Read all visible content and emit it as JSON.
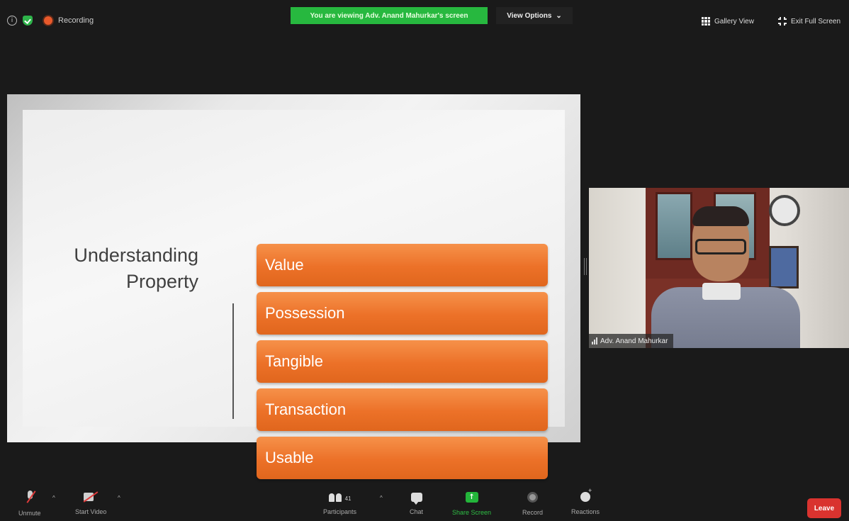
{
  "top_bar": {
    "recording_label": "Recording",
    "viewing_banner": "You are viewing Adv. Anand Mahurkar's screen",
    "view_options_label": "View Options",
    "gallery_view_label": "Gallery View",
    "exit_full_screen_label": "Exit Full Screen"
  },
  "slide": {
    "title_line1": "Understanding",
    "title_line2": "Property",
    "items": [
      "Value",
      "Possession",
      "Tangible",
      "Transaction",
      "Usable"
    ],
    "accent_color": "#ED7D31"
  },
  "video": {
    "participant_name": "Adv. Anand Mahurkar"
  },
  "toolbar": {
    "unmute_label": "Unmute",
    "start_video_label": "Start Video",
    "participants_label": "Participants",
    "participants_count": "41",
    "chat_label": "Chat",
    "share_screen_label": "Share Screen",
    "record_label": "Record",
    "reactions_label": "Reactions",
    "leave_label": "Leave"
  },
  "colors": {
    "banner_green": "#27B83F",
    "leave_red": "#D9332F",
    "background": "#1A1A1A"
  }
}
